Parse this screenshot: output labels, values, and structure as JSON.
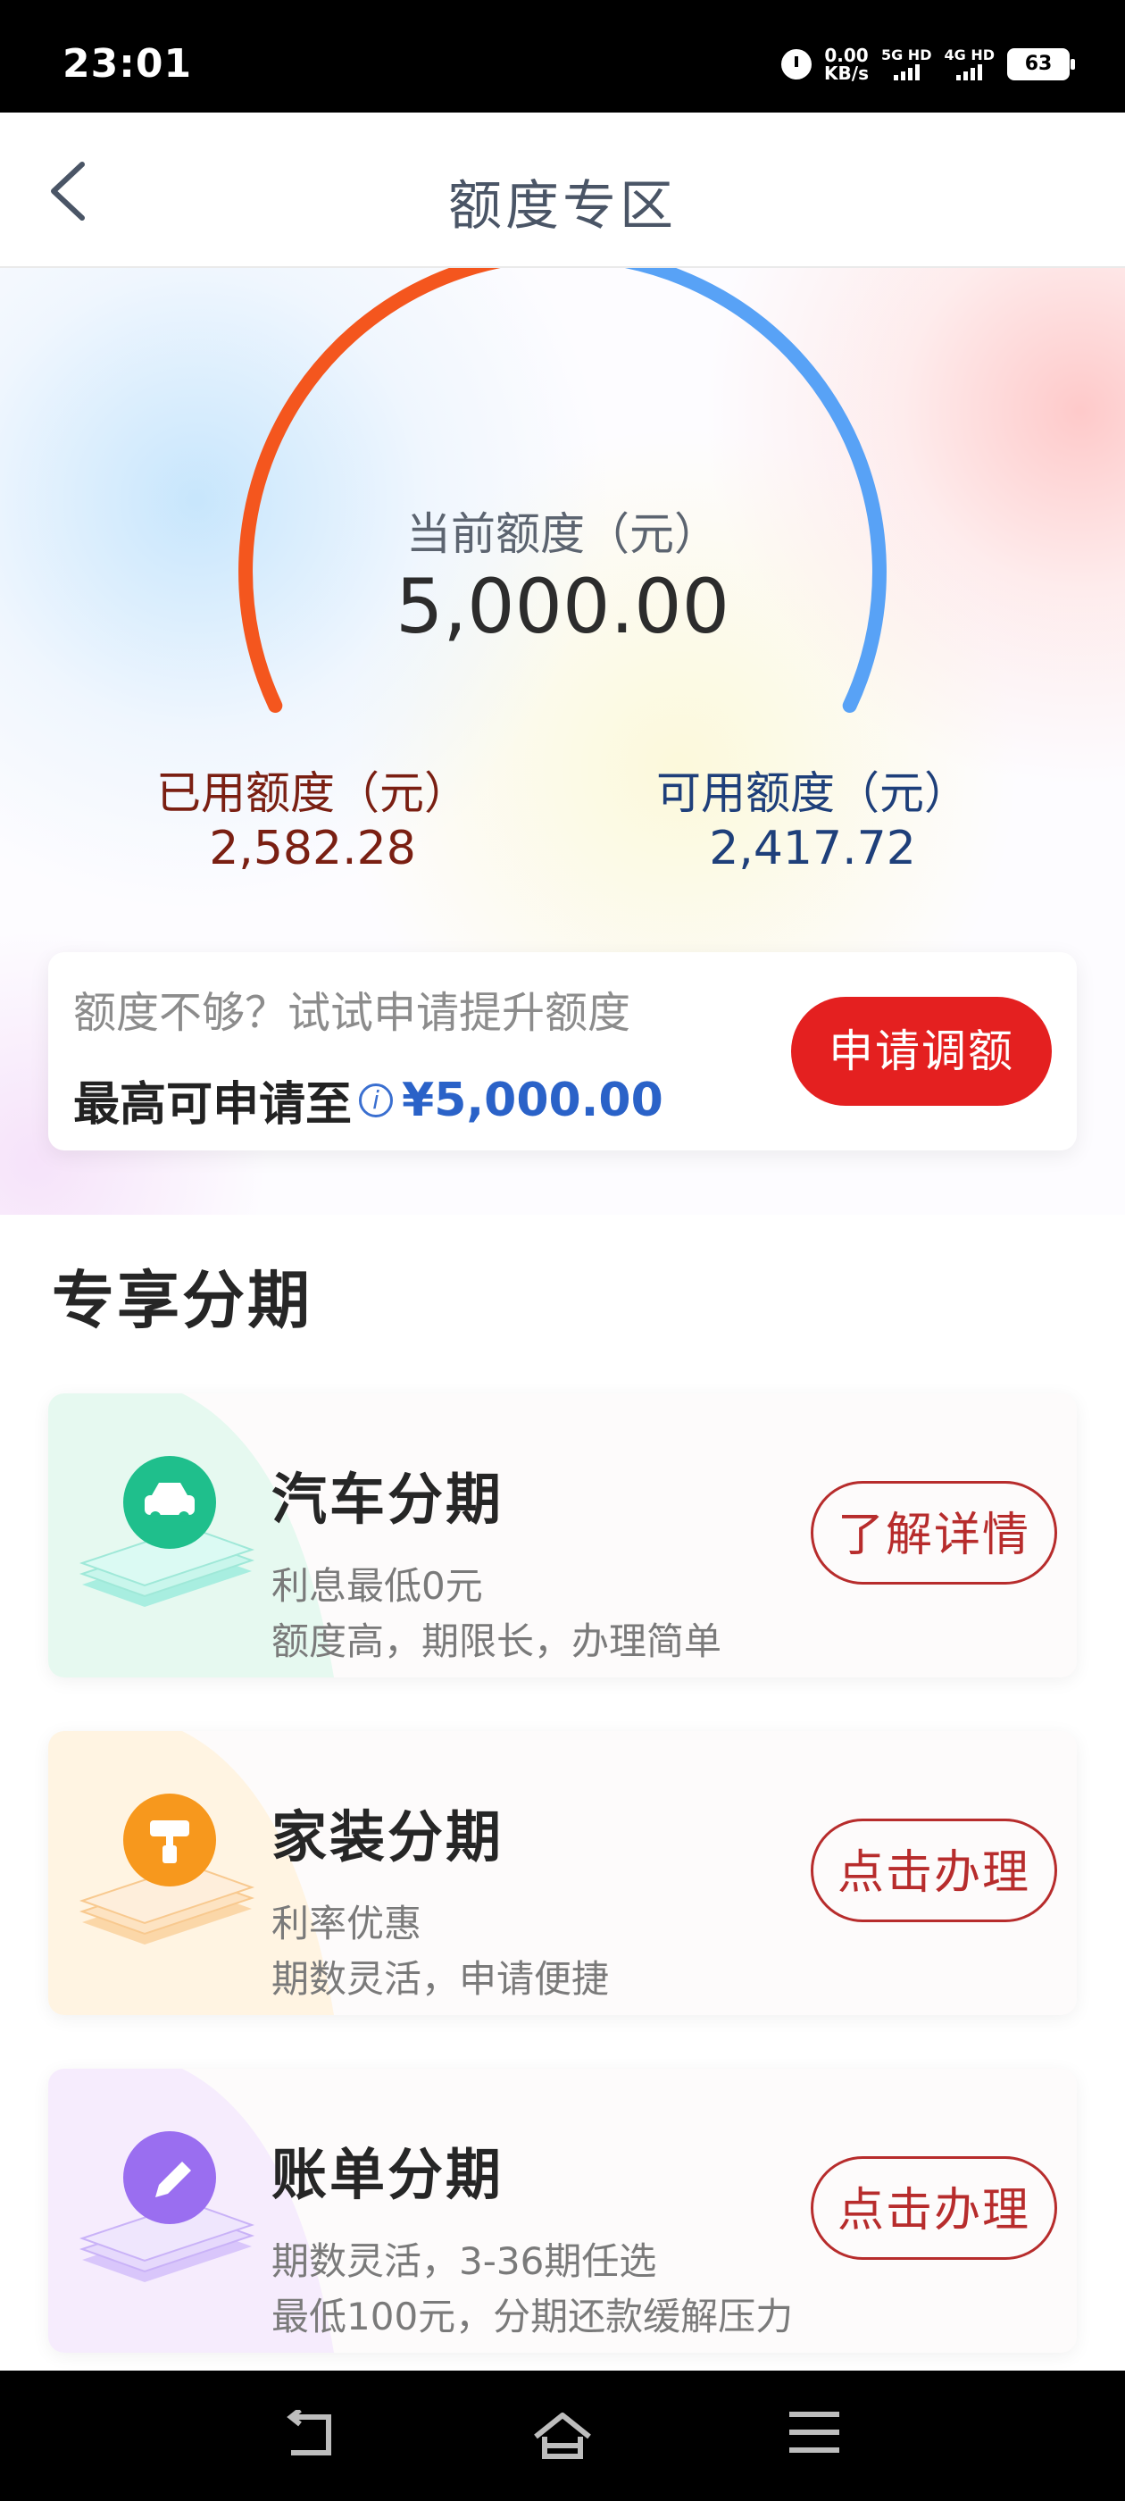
{
  "status_bar": {
    "time": "23:01",
    "net_speed_value": "0.00",
    "net_speed_unit": "KB/s",
    "sim1_label": "5G HD",
    "sim2_label": "4G HD",
    "battery": "63"
  },
  "header": {
    "title": "额度专区"
  },
  "credit": {
    "current_label": "当前额度（元）",
    "current_value": "5,000.00",
    "used_label": "已用额度（元）",
    "used_value": "2,582.28",
    "available_label": "可用额度（元）",
    "available_value": "2,417.72",
    "used_fraction": 0.516,
    "colors": {
      "used": "#f4561e",
      "available": "#58a2f6"
    }
  },
  "promo": {
    "text": "额度不够？试试申请提升额度",
    "max_label": "最高可申请至",
    "max_amount": "¥5,000.00",
    "button_label": "申请调额"
  },
  "section": {
    "title": "专享分期"
  },
  "cards": [
    {
      "title": "汽车分期",
      "line1": "利息最低0元",
      "line2": "额度高，期限长，办理简单",
      "button": "了解详情",
      "icon": "car-icon",
      "color": "#1fbf8c"
    },
    {
      "title": "家装分期",
      "line1": "利率优惠",
      "line2": "期数灵活，申请便捷",
      "button": "点击办理",
      "icon": "paint-roller-icon",
      "color": "#f7981d"
    },
    {
      "title": "账单分期",
      "line1": "期数灵活，3-36期任选",
      "line2": "最低100元，分期还款缓解压力",
      "button": "点击办理",
      "icon": "pencil-icon",
      "color": "#9a6ef0"
    }
  ]
}
